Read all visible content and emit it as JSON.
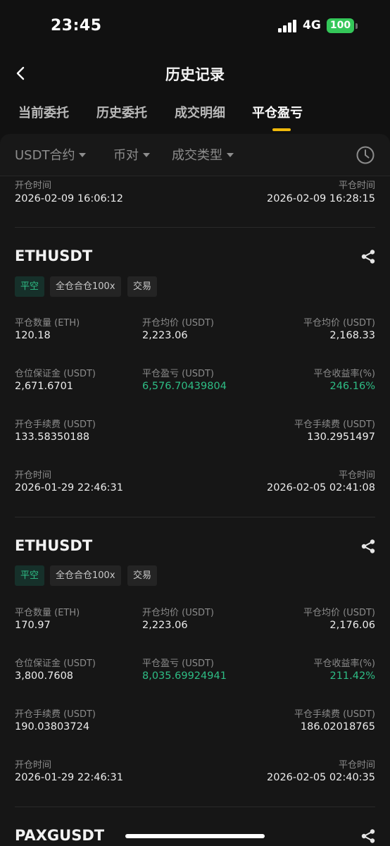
{
  "status": {
    "time": "23:45",
    "network": "4G",
    "battery": "100"
  },
  "nav": {
    "title": "历史记录"
  },
  "tabs": [
    {
      "label": "当前委托"
    },
    {
      "label": "历史委托"
    },
    {
      "label": "成交明细"
    },
    {
      "label": "平仓盈亏"
    }
  ],
  "active_tab": "平仓盈亏",
  "filters": [
    {
      "label": "USDT合约"
    },
    {
      "label": "币对"
    },
    {
      "label": "成交类型"
    }
  ],
  "partial_record": {
    "open_time_label": "开仓时间",
    "open_time": "2026-02-09 16:06:12",
    "close_time_label": "平仓时间",
    "close_time": "2026-02-09 16:28:15"
  },
  "records": [
    {
      "symbol": "ETHUSDT",
      "tags": [
        "平空",
        "全仓合仓100x",
        "交易"
      ],
      "close_qty_label": "平仓数量 (ETH)",
      "close_qty": "120.18",
      "open_avg_label": "开仓均价 (USDT)",
      "open_avg": "2,223.06",
      "close_avg_label": "平仓均价 (USDT)",
      "close_avg": "2,168.33",
      "margin_label": "仓位保证金 (USDT)",
      "margin": "2,671.6701",
      "pnl_label": "平仓盈亏 (USDT)",
      "pnl": "6,576.70439804",
      "roi_label": "平仓收益率(%)",
      "roi": "246.16%",
      "open_fee_label": "开仓手续费 (USDT)",
      "open_fee": "133.58350188",
      "close_fee_label": "平仓手续费 (USDT)",
      "close_fee": "130.2951497",
      "open_time_label": "开仓时间",
      "open_time": "2026-01-29 22:46:31",
      "close_time_label": "平仓时间",
      "close_time": "2026-02-05 02:41:08"
    },
    {
      "symbol": "ETHUSDT",
      "tags": [
        "平空",
        "全仓合仓100x",
        "交易"
      ],
      "close_qty_label": "平仓数量 (ETH)",
      "close_qty": "170.97",
      "open_avg_label": "开仓均价 (USDT)",
      "open_avg": "2,223.06",
      "close_avg_label": "平仓均价 (USDT)",
      "close_avg": "2,176.06",
      "margin_label": "仓位保证金 (USDT)",
      "margin": "3,800.7608",
      "pnl_label": "平仓盈亏 (USDT)",
      "pnl": "8,035.69924941",
      "roi_label": "平仓收益率(%)",
      "roi": "211.42%",
      "open_fee_label": "开仓手续费 (USDT)",
      "open_fee": "190.03803724",
      "close_fee_label": "平仓手续费 (USDT)",
      "close_fee": "186.02018765",
      "open_time_label": "开仓时间",
      "open_time": "2026-01-29 22:46:31",
      "close_time_label": "平仓时间",
      "close_time": "2026-02-05 02:40:35"
    }
  ],
  "next_record": {
    "symbol": "PAXGUSDT"
  },
  "colors": {
    "profit": "#2ebd85",
    "accent": "#f0b90b",
    "battery": "#34c759",
    "background": "#111111"
  }
}
